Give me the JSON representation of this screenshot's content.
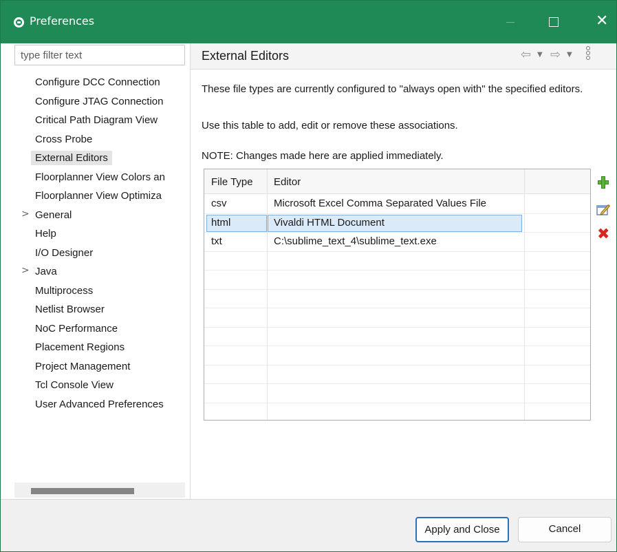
{
  "window": {
    "title": "Preferences",
    "colors": {
      "titlebar": "#1f8a55",
      "selection": "#dbeaf9",
      "selection_border": "#7db1e1",
      "default_button_border": "#2a6fc0"
    }
  },
  "filter": {
    "placeholder": "type filter text",
    "value": ""
  },
  "tree": {
    "items": [
      {
        "label": "Configure DCC Connection",
        "expandable": false,
        "selected": false
      },
      {
        "label": "Configure JTAG Connection",
        "expandable": false,
        "selected": false
      },
      {
        "label": "Critical Path Diagram View",
        "expandable": false,
        "selected": false
      },
      {
        "label": "Cross Probe",
        "expandable": false,
        "selected": false
      },
      {
        "label": "External Editors",
        "expandable": false,
        "selected": true
      },
      {
        "label": "Floorplanner View Colors an",
        "expandable": false,
        "selected": false
      },
      {
        "label": "Floorplanner View Optimiza",
        "expandable": false,
        "selected": false
      },
      {
        "label": "General",
        "expandable": true,
        "selected": false
      },
      {
        "label": "Help",
        "expandable": false,
        "selected": false
      },
      {
        "label": "I/O Designer",
        "expandable": false,
        "selected": false
      },
      {
        "label": "Java",
        "expandable": true,
        "selected": false
      },
      {
        "label": "Multiprocess",
        "expandable": false,
        "selected": false
      },
      {
        "label": "Netlist Browser",
        "expandable": false,
        "selected": false
      },
      {
        "label": "NoC Performance",
        "expandable": false,
        "selected": false
      },
      {
        "label": "Placement Regions",
        "expandable": false,
        "selected": false
      },
      {
        "label": "Project Management",
        "expandable": false,
        "selected": false
      },
      {
        "label": "Tcl Console View",
        "expandable": false,
        "selected": false
      },
      {
        "label": "User Advanced Preferences",
        "expandable": false,
        "selected": false
      }
    ],
    "expander_glyph": ">"
  },
  "page": {
    "title": "External Editors",
    "description": "These file types are currently configured to \"always open with\" the specified editors.",
    "instruction": "Use this table to add, edit or remove these associations.",
    "note": "NOTE: Changes made here are applied immediately.",
    "nav_icons": [
      "back-arrow-icon",
      "dropdown-icon",
      "forward-arrow-icon",
      "dropdown-icon",
      "more-vertical-icon"
    ]
  },
  "table": {
    "columns": [
      "File Type",
      "Editor"
    ],
    "rows": [
      {
        "file_type": "csv",
        "editor": "Microsoft Excel Comma Separated Values File",
        "selected": false
      },
      {
        "file_type": "html",
        "editor": "Vivaldi HTML Document",
        "selected": true
      },
      {
        "file_type": "txt",
        "editor": "C:\\sublime_text_4\\sublime_text.exe",
        "selected": false
      }
    ]
  },
  "side_buttons": [
    {
      "icon": "add-icon"
    },
    {
      "icon": "edit-icon"
    },
    {
      "icon": "remove-icon"
    }
  ],
  "buttons": {
    "apply_and_close": "Apply and Close",
    "cancel": "Cancel"
  }
}
